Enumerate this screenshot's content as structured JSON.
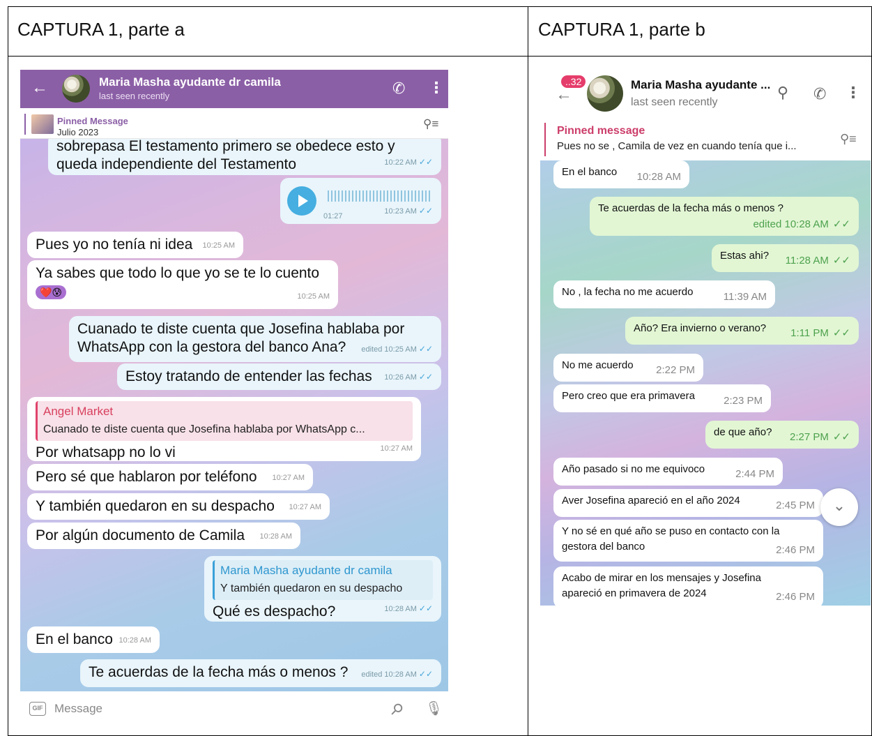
{
  "document": {
    "title_a": "CAPTURA 1, parte a",
    "title_b": "CAPTURA 1, parte b"
  },
  "shot_a": {
    "header": {
      "contact_name": "Maria Masha ayudante dr camila",
      "status": "last seen recently"
    },
    "pinned": {
      "title": "Pinned Message",
      "subtitle": "Julio 2023"
    },
    "messages": [
      {
        "text_1": "sobrepasa El testamento primero se obedece esto y",
        "text_2": "queda independiente del Testamento",
        "time": "10:22 AM"
      },
      {
        "voice_duration": "01:27",
        "time": "10:23 AM"
      },
      {
        "text": "Pues yo no tenía ni idea",
        "time": "10:25 AM"
      },
      {
        "text": "Ya sabes que todo lo que yo se te lo cuento",
        "reaction": "❤️😰",
        "time": "10:25 AM"
      },
      {
        "text_1": "Cuanado te diste cuenta que Josefina hablaba por",
        "text_2": "WhatsApp con la gestora del banco Ana?",
        "time": "edited 10:25 AM"
      },
      {
        "text": "Estoy tratando de entender las fechas",
        "time": "10:26 AM"
      },
      {
        "reply_name": "Angel Market",
        "reply_text": "Cuanado te diste cuenta que Josefina hablaba por WhatsApp c...",
        "text": "Por whatsapp no lo vi",
        "time": "10:27 AM"
      },
      {
        "text": "Pero sé que hablaron por teléfono",
        "time": "10:27 AM"
      },
      {
        "text": "Y también quedaron en su despacho",
        "time": "10:27 AM"
      },
      {
        "text": "Por algún documento de Camila",
        "time": "10:28 AM"
      },
      {
        "reply_name": "Maria Masha ayudante dr camila",
        "reply_text": "Y también quedaron en su despacho",
        "text": "Qué es despacho?",
        "time": "10:28 AM"
      },
      {
        "text": "En el banco",
        "time": "10:28 AM"
      },
      {
        "text": "Te acuerdas de la fecha más o menos ?",
        "time": "edited 10:28 AM"
      }
    ],
    "composer": {
      "gif_label": "GIF",
      "placeholder": "Message"
    }
  },
  "shot_b": {
    "header": {
      "unread_badge": "..32",
      "contact_name": "Maria Masha ayudante ...",
      "status": "last seen recently"
    },
    "pinned": {
      "title": "Pinned message",
      "subtitle": "Pues no se , Camila de vez en cuando tenía que i..."
    },
    "messages": [
      {
        "text": "En el banco",
        "time": "10:28 AM"
      },
      {
        "text": "Te acuerdas de la fecha más o menos ?",
        "time": "edited 10:28 AM"
      },
      {
        "text": "Estas ahi?",
        "time": "11:28 AM"
      },
      {
        "text": "No , la fecha no me acuerdo",
        "time": "11:39 AM"
      },
      {
        "text": "Año? Era invierno o verano?",
        "time": "1:11 PM"
      },
      {
        "text": "No me acuerdo",
        "time": "2:22 PM"
      },
      {
        "text": "Pero creo que era primavera",
        "time": "2:23 PM"
      },
      {
        "text": "de que año?",
        "time": "2:27 PM"
      },
      {
        "text": "Año pasado si no me equivoco",
        "time": "2:44 PM"
      },
      {
        "text": "Aver Josefina apareció en el año 2024",
        "time": "2:45 PM"
      },
      {
        "text_1": "Y no sé en qué año se puso en contacto con la",
        "text_2": "gestora del banco",
        "time": "2:46 PM"
      },
      {
        "text_1": "Acabo de mirar en los mensajes y Josefina",
        "text_2": "apareció en primavera de 2024",
        "time": "2:46 PM"
      }
    ]
  },
  "icons": {
    "back": "arrow-left-icon",
    "phone": "phone-icon",
    "more": "more-vertical-icon",
    "pin": "pin-list-icon",
    "search": "search-icon",
    "attach": "paperclip-icon",
    "mic": "microphone-icon",
    "scroll_down": "chevron-down-icon"
  },
  "colors": {
    "telegram_purple": "#8b5fa6",
    "pinned_pink": "#cc3d6a",
    "outgoing_green": "#e2f6d4",
    "outgoing_blue": "#e9f5fb"
  }
}
